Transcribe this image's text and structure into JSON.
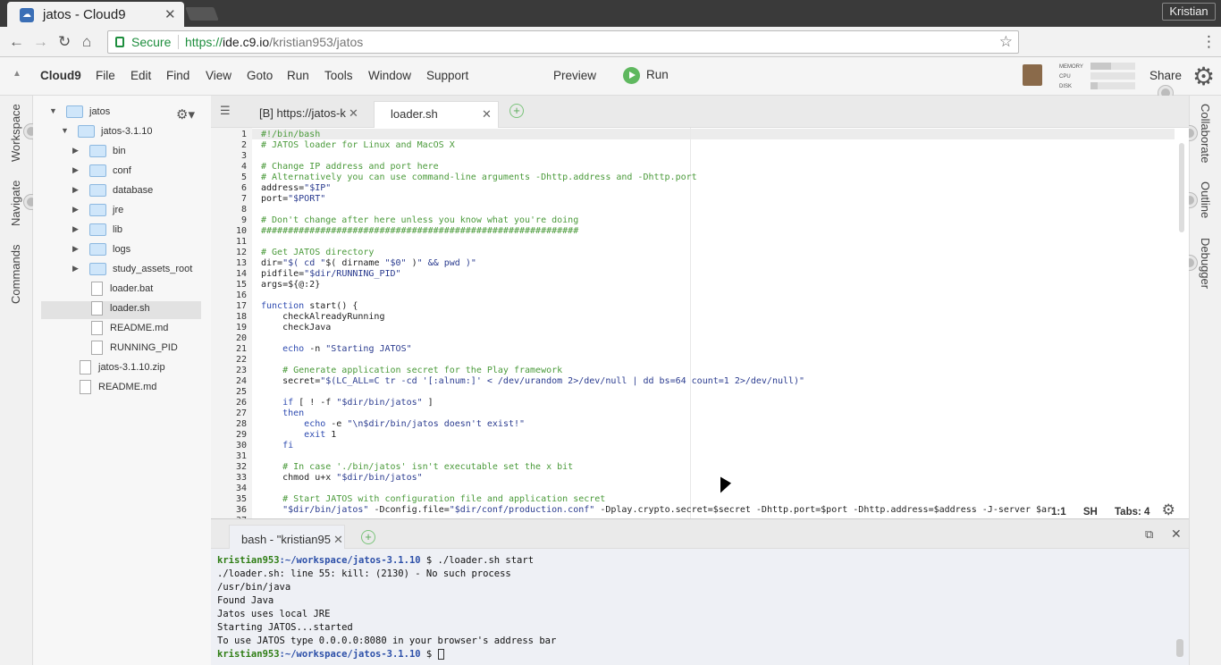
{
  "browser": {
    "tab_title": "jatos - Cloud9",
    "profile": "Kristian",
    "secure_label": "Secure",
    "url_scheme": "https://",
    "url_domain": "ide.c9.io",
    "url_path": "/kristian953/jatos",
    "ext_badge": "5"
  },
  "menu": {
    "brand": "Cloud9",
    "items": [
      "File",
      "Edit",
      "Find",
      "View",
      "Goto",
      "Run",
      "Tools",
      "Window",
      "Support"
    ],
    "preview": "Preview",
    "run": "Run",
    "share": "Share",
    "meters": [
      "MEMORY",
      "CPU",
      "DISK"
    ],
    "meter_values": [
      0.45,
      0,
      0.15
    ]
  },
  "left_panels": [
    "Workspace",
    "Navigate",
    "Commands"
  ],
  "right_panels": [
    "Collaborate",
    "Outline",
    "Debugger"
  ],
  "tree": [
    {
      "label": "jatos",
      "type": "folder",
      "depth": 0,
      "open": true
    },
    {
      "label": "jatos-3.1.10",
      "type": "folder",
      "depth": 1,
      "open": true
    },
    {
      "label": "bin",
      "type": "folder",
      "depth": 2,
      "open": false
    },
    {
      "label": "conf",
      "type": "folder",
      "depth": 2,
      "open": false
    },
    {
      "label": "database",
      "type": "folder",
      "depth": 2,
      "open": false
    },
    {
      "label": "jre",
      "type": "folder",
      "depth": 2,
      "open": false
    },
    {
      "label": "lib",
      "type": "folder",
      "depth": 2,
      "open": false
    },
    {
      "label": "logs",
      "type": "folder",
      "depth": 2,
      "open": false
    },
    {
      "label": "study_assets_root",
      "type": "folder",
      "depth": 2,
      "open": false
    },
    {
      "label": "loader.bat",
      "type": "file",
      "depth": 2
    },
    {
      "label": "loader.sh",
      "type": "file",
      "depth": 2,
      "selected": true
    },
    {
      "label": "README.md",
      "type": "file",
      "depth": 2
    },
    {
      "label": "RUNNING_PID",
      "type": "file",
      "depth": 2
    },
    {
      "label": "jatos-3.1.10.zip",
      "type": "file",
      "depth": 1
    },
    {
      "label": "README.md",
      "type": "file",
      "depth": 1
    }
  ],
  "editor_tabs": [
    "[B] https://jatos-k",
    "loader.sh"
  ],
  "code": [
    "#!/bin/bash",
    "# JATOS loader for Linux and MacOS X",
    "",
    "# Change IP address and port here",
    "# Alternatively you can use command-line arguments -Dhttp.address and -Dhttp.port",
    "address=\"$IP\"",
    "port=\"$PORT\"",
    "",
    "# Don't change after here unless you know what you're doing",
    "###########################################################",
    "",
    "# Get JATOS directory",
    "dir=\"$( cd \"$( dirname \"$0\" )\" && pwd )\"",
    "pidfile=\"$dir/RUNNING_PID\"",
    "args=${@:2}",
    "",
    "function start() {",
    "    checkAlreadyRunning",
    "    checkJava",
    "",
    "    echo -n \"Starting JATOS\"",
    "",
    "    # Generate application secret for the Play framework",
    "    secret=\"$(LC_ALL=C tr -cd '[:alnum:]' < /dev/urandom 2>/dev/null | dd bs=64 count=1 2>/dev/null)\"",
    "",
    "    if [ ! -f \"$dir/bin/jatos\" ]",
    "    then",
    "        echo -e \"\\n$dir/bin/jatos doesn't exist!\"",
    "        exit 1",
    "    fi",
    "",
    "    # In case './bin/jatos' isn't executable set the x bit",
    "    chmod u+x \"$dir/bin/jatos\"",
    "",
    "    # Start JATOS with configuration file and application secret",
    "    \"$dir/bin/jatos\" -Dconfig.file=\"$dir/conf/production.conf\" -Dplay.crypto.secret=$secret -Dhttp.port=$port -Dhttp.address=$address -J-server $ar"
  ],
  "status": {
    "pos": "1:1",
    "mode": "SH",
    "tabs": "Tabs: 4"
  },
  "terminal": {
    "tab": "bash - \"kristian95",
    "prompt_user": "kristian953",
    "prompt_path": ":~/workspace/jatos-3.1.10",
    "command": " $ ./loader.sh start",
    "output": [
      "./loader.sh: line 55: kill: (2130) - No such process",
      "/usr/bin/java",
      "Found Java",
      "Jatos uses local JRE",
      "Starting JATOS...started",
      "To use JATOS type 0.0.0.0:8080 in your browser's address bar"
    ],
    "final_prompt": " $ "
  }
}
